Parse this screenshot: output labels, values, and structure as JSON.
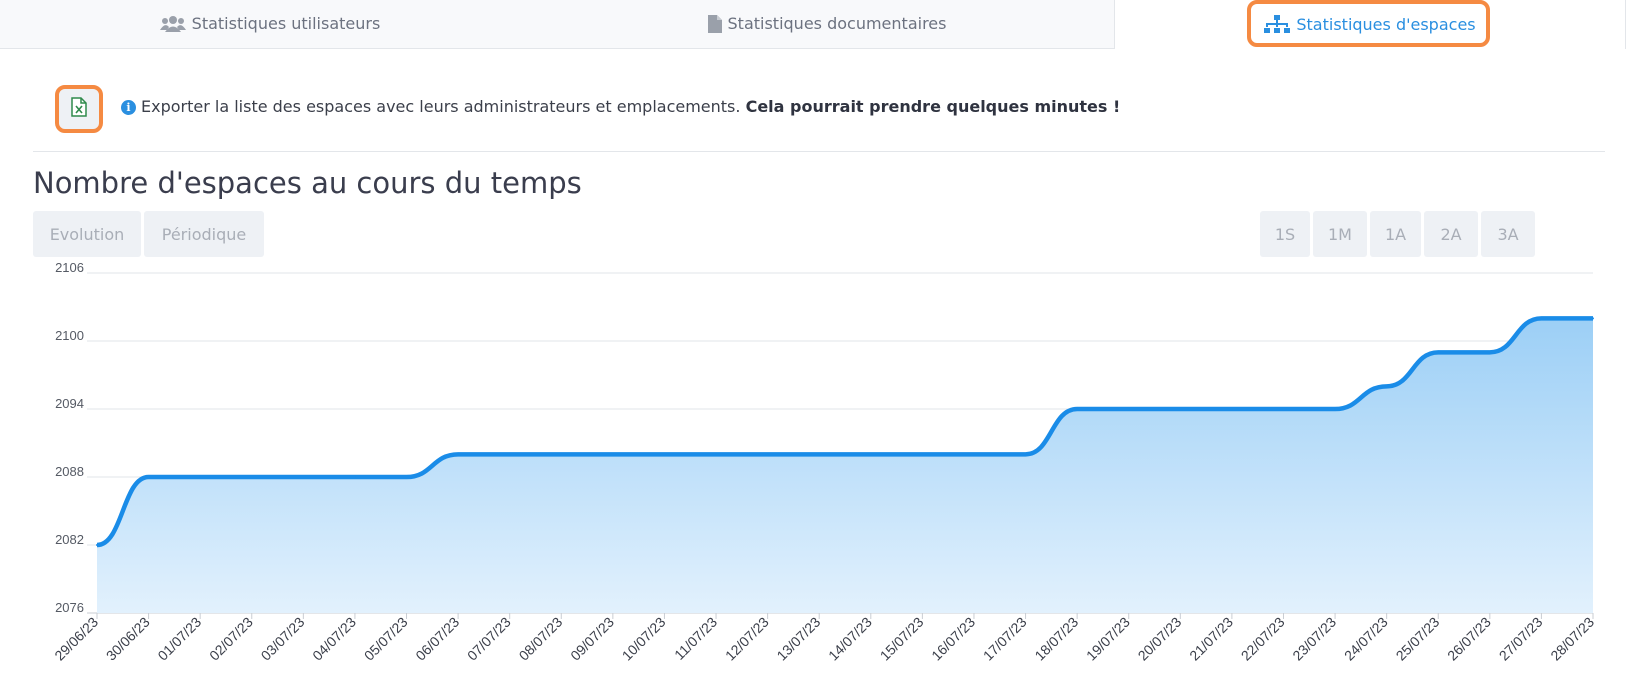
{
  "tabs": [
    {
      "label": "Statistiques utilisateurs",
      "icon": "users-icon"
    },
    {
      "label": "Statistiques documentaires",
      "icon": "file-icon"
    },
    {
      "label": "Statistiques d'espaces",
      "icon": "sitemap-icon",
      "active": true
    }
  ],
  "export": {
    "icon": "excel-file-icon",
    "text": "Exporter la liste des espaces avec leurs administrateurs et emplacements.",
    "warning": "Cela pourrait prendre quelques minutes !"
  },
  "section_title": "Nombre d'espaces au cours du temps",
  "view_buttons": [
    "Evolution",
    "Périodique"
  ],
  "range_buttons": [
    "1S",
    "1M",
    "1A",
    "2A",
    "3A"
  ],
  "colors": {
    "accent": "#2a8fe0",
    "line": "#1a8ce8",
    "area_top": "#9ccff6",
    "area_bottom": "#e2f1fd",
    "highlight": "#f58a42"
  },
  "chart_data": {
    "type": "area",
    "title": "Nombre d'espaces au cours du temps",
    "x": [
      "29/06/23",
      "30/06/23",
      "01/07/23",
      "02/07/23",
      "03/07/23",
      "04/07/23",
      "05/07/23",
      "06/07/23",
      "07/07/23",
      "08/07/23",
      "09/07/23",
      "10/07/23",
      "11/07/23",
      "12/07/23",
      "13/07/23",
      "14/07/23",
      "15/07/23",
      "16/07/23",
      "17/07/23",
      "18/07/23",
      "19/07/23",
      "20/07/23",
      "21/07/23",
      "22/07/23",
      "23/07/23",
      "24/07/23",
      "25/07/23",
      "26/07/23",
      "27/07/23",
      "28/07/23"
    ],
    "values": [
      2082,
      2088,
      2088,
      2088,
      2088,
      2088,
      2088,
      2090,
      2090,
      2090,
      2090,
      2090,
      2090,
      2090,
      2090,
      2090,
      2090,
      2090,
      2090,
      2094,
      2094,
      2094,
      2094,
      2094,
      2094,
      2096,
      2099,
      2099,
      2102,
      2102
    ],
    "yticks": [
      2076,
      2082,
      2088,
      2094,
      2100,
      2106
    ],
    "ylim": [
      2076,
      2106
    ],
    "grid": true,
    "legend": "none"
  }
}
